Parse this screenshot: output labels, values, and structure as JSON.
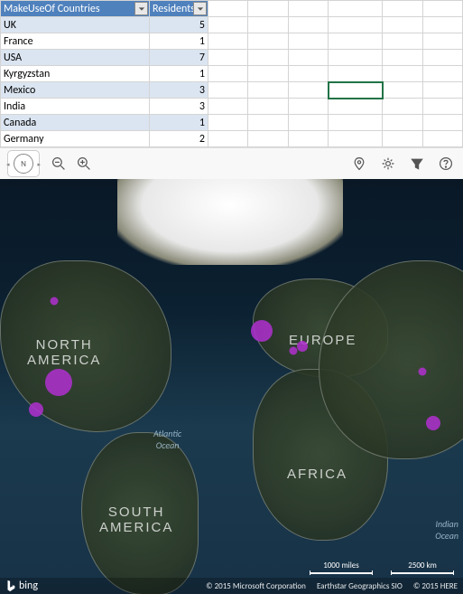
{
  "table": {
    "headers": [
      "MakeUseOf Countries",
      "Residents"
    ],
    "rows": [
      {
        "country": "UK",
        "residents": 5
      },
      {
        "country": "France",
        "residents": 1
      },
      {
        "country": "USA",
        "residents": 7
      },
      {
        "country": "Kyrgyzstan",
        "residents": 1
      },
      {
        "country": "Mexico",
        "residents": 3
      },
      {
        "country": "India",
        "residents": 3
      },
      {
        "country": "Canada",
        "residents": 1
      },
      {
        "country": "Germany",
        "residents": 2
      }
    ]
  },
  "compass": {
    "label": "N"
  },
  "map": {
    "continent_labels": {
      "na1": "NORTH",
      "na2": "AMERICA",
      "sa1": "SOUTH",
      "sa2": "AMERICA",
      "eu": "EUROPE",
      "af": "AFRICA"
    },
    "water": {
      "atlantic1": "Atlantic",
      "atlantic2": "Ocean",
      "indian1": "Indian",
      "indian2": "Ocean"
    },
    "scale": {
      "miles": "1000 miles",
      "km": "2500 km"
    },
    "attribution": {
      "brand": "bing",
      "ms": "© 2015 Microsoft Corporation",
      "earthstar": "Earthstar Geographics SIO",
      "here": "© 2015 HERE"
    }
  }
}
